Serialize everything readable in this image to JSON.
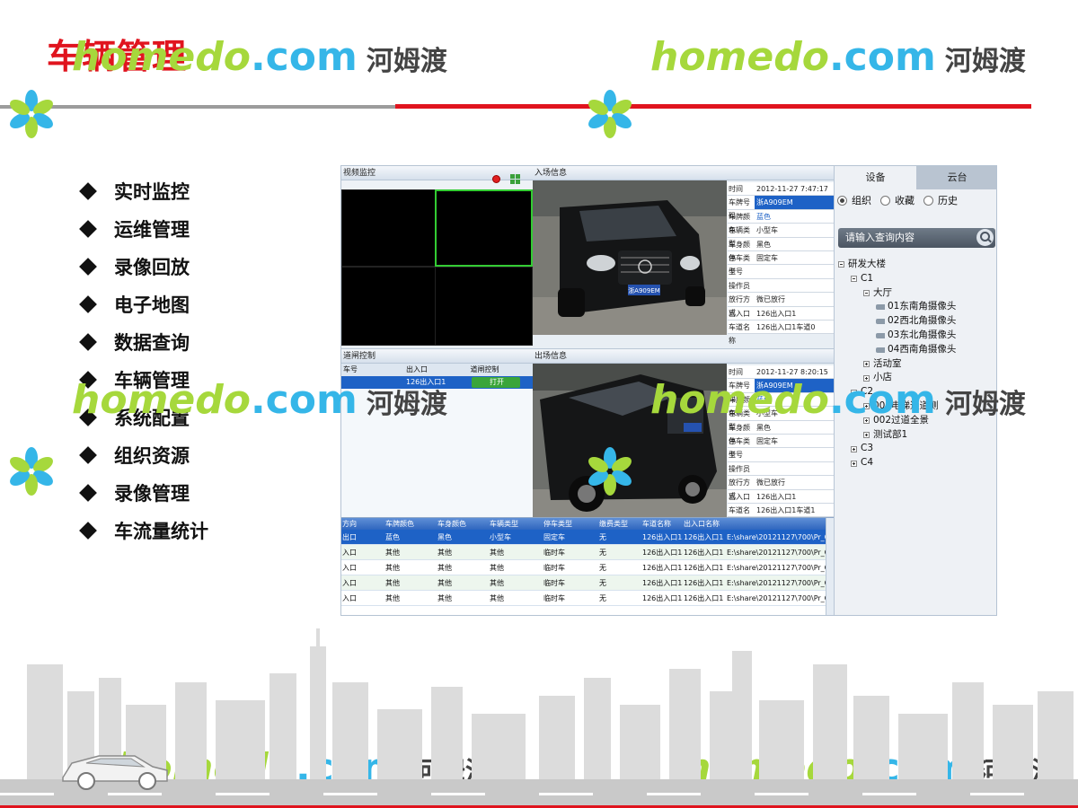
{
  "slide": {
    "title": "车辆管理",
    "menu": [
      "实时监控",
      "运维管理",
      "录像回放",
      "电子地图",
      "数据查询",
      "车辆管理",
      "系统配置",
      "组织资源",
      "录像管理",
      "车流量统计"
    ]
  },
  "watermark": {
    "home": "homedo",
    "dot_com": ".com",
    "cn": "河姆渡"
  },
  "app": {
    "video_panel": {
      "title": "视频监控"
    },
    "gate_panel": {
      "title": "道闸控制",
      "headers": [
        "车号",
        "",
        "出入口",
        "道闸控制"
      ],
      "row": [
        "",
        "",
        "126出入口1",
        "打开"
      ]
    },
    "entry": {
      "title": "入场信息",
      "fields": [
        {
          "k": "时间",
          "v": "2012-11-27 7:47:17"
        },
        {
          "k": "车牌号码",
          "v": "浙A909EM"
        },
        {
          "k": "车牌颜色",
          "v": "蓝色"
        },
        {
          "k": "车辆类型",
          "v": "小型车"
        },
        {
          "k": "车身颜色",
          "v": "黑色"
        },
        {
          "k": "停车类型",
          "v": "固定车"
        },
        {
          "k": "卡号",
          "v": ""
        },
        {
          "k": "操作员",
          "v": ""
        },
        {
          "k": "放行方式",
          "v": "微已放行"
        },
        {
          "k": "出入口",
          "v": "126出入口1"
        },
        {
          "k": "车道名称",
          "v": "126出入口1车道0"
        }
      ],
      "plate": "浙A909EM"
    },
    "exit": {
      "title": "出场信息",
      "fields": [
        {
          "k": "时间",
          "v": "2012-11-27 8:20:15"
        },
        {
          "k": "车牌号码",
          "v": "浙A909EM"
        },
        {
          "k": "车牌颜色",
          "v": "蓝色"
        },
        {
          "k": "车辆类型",
          "v": "小型车"
        },
        {
          "k": "车身颜色",
          "v": "黑色"
        },
        {
          "k": "停车类型",
          "v": "固定车"
        },
        {
          "k": "卡号",
          "v": ""
        },
        {
          "k": "操作员",
          "v": ""
        },
        {
          "k": "放行方式",
          "v": "微已放行"
        },
        {
          "k": "出入口",
          "v": "126出入口1"
        },
        {
          "k": "车道名称",
          "v": "126出入口1车道1"
        }
      ]
    },
    "records": {
      "headers": [
        "方向",
        "车牌颜色",
        "车身颜色",
        "车辆类型",
        "停车类型",
        "缴费类型",
        "车道名称",
        "出入口名称",
        ""
      ],
      "rows": [
        [
          "出口",
          "蓝色",
          "黑色",
          "小型车",
          "固定车",
          "无",
          "126出入口1车道1",
          "126出入口1",
          "E:\\share\\20121127\\700\\Pr_C"
        ],
        [
          "入口",
          "其他",
          "其他",
          "其他",
          "临时车",
          "无",
          "126出入口1车道1",
          "126出入口1",
          "E:\\share\\20121127\\700\\Pr_C"
        ],
        [
          "入口",
          "其他",
          "其他",
          "其他",
          "临时车",
          "无",
          "126出入口1车道1",
          "126出入口1",
          "E:\\share\\20121127\\700\\Pr_C"
        ],
        [
          "入口",
          "其他",
          "其他",
          "其他",
          "临时车",
          "无",
          "126出入口1车道1",
          "126出入口1",
          "E:\\share\\20121127\\700\\Pr_C"
        ],
        [
          "入口",
          "其他",
          "其他",
          "其他",
          "临时车",
          "无",
          "126出入口1车道1",
          "126出入口1",
          "E:\\share\\20121127\\700\\Pr_C"
        ]
      ]
    },
    "side": {
      "tabs": [
        "设备",
        "云台"
      ],
      "radios": [
        "组织",
        "收藏",
        "历史"
      ],
      "search_placeholder": "请输入查询内容",
      "tree": [
        {
          "label": "研发大楼",
          "depth": 0,
          "toggle": "minus"
        },
        {
          "label": "C1",
          "depth": 1,
          "toggle": "minus"
        },
        {
          "label": "大厅",
          "depth": 2,
          "toggle": "minus"
        },
        {
          "label": "01东南角摄像头",
          "depth": 3,
          "toggle": "cam"
        },
        {
          "label": "02西北角摄像头",
          "depth": 3,
          "toggle": "cam"
        },
        {
          "label": "03东北角摄像头",
          "depth": 3,
          "toggle": "cam"
        },
        {
          "label": "04西南角摄像头",
          "depth": 3,
          "toggle": "cam"
        },
        {
          "label": "活动室",
          "depth": 2,
          "toggle": "plus"
        },
        {
          "label": "小店",
          "depth": 2,
          "toggle": "plus"
        },
        {
          "label": "C2",
          "depth": 1,
          "toggle": "minus"
        },
        {
          "label": "001电梯通道侧",
          "depth": 2,
          "toggle": "plus"
        },
        {
          "label": "002过道全景",
          "depth": 2,
          "toggle": "plus"
        },
        {
          "label": "测试部1",
          "depth": 2,
          "toggle": "plus"
        },
        {
          "label": "C3",
          "depth": 1,
          "toggle": "plus"
        },
        {
          "label": "C4",
          "depth": 1,
          "toggle": "plus"
        }
      ]
    }
  },
  "colors": {
    "title_red": "#e0141e",
    "selection_blue": "#1e62c6",
    "gate_open_green": "#3aa53a",
    "watermark_green": "#a6d83c",
    "watermark_blue": "#35b6e8"
  }
}
